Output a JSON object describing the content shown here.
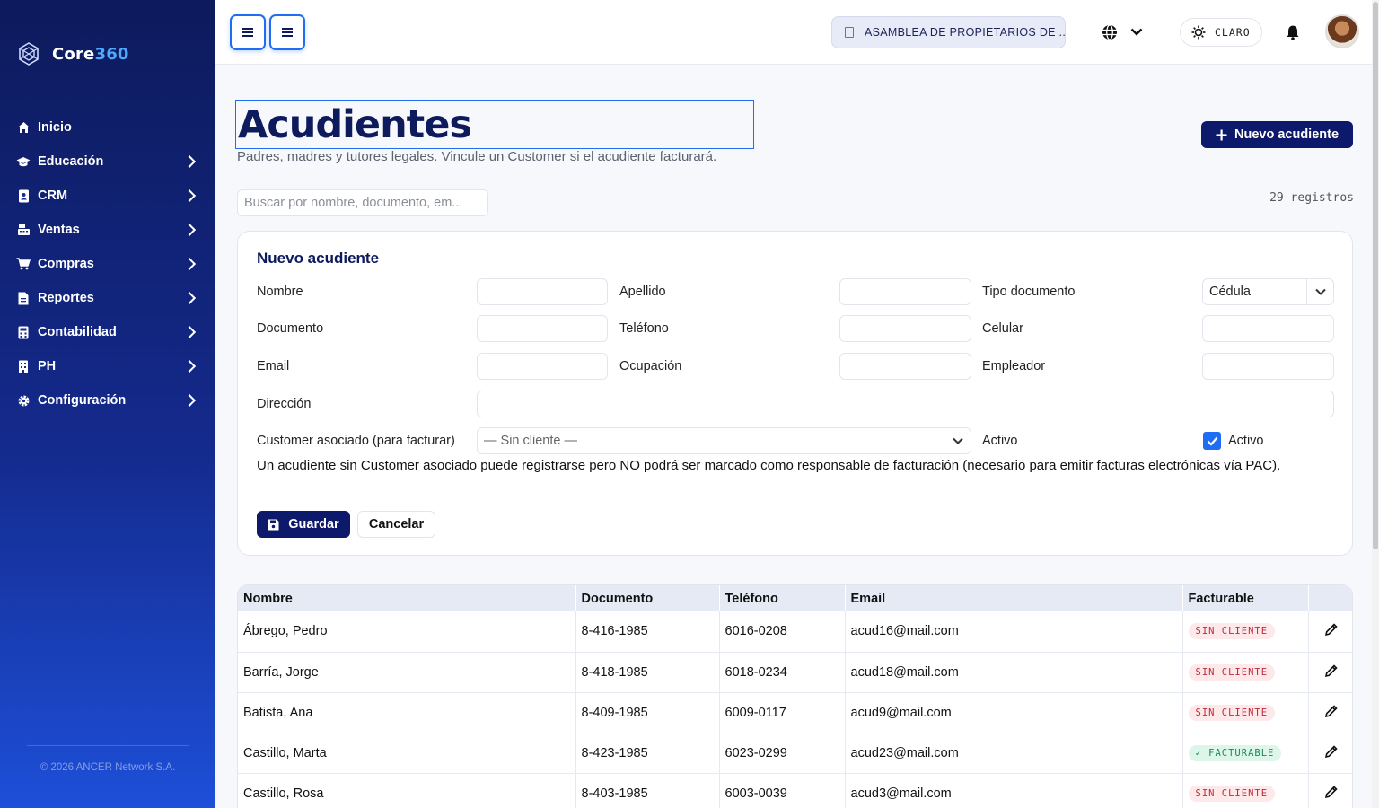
{
  "brand": {
    "name_part1": "Core",
    "name_part2": "360"
  },
  "sidebar": {
    "items": [
      {
        "label": "Inicio",
        "icon": "home-icon",
        "has_children": false
      },
      {
        "label": "Educación",
        "icon": "graduation-cap-icon",
        "has_children": true
      },
      {
        "label": "CRM",
        "icon": "contact-book-icon",
        "has_children": true
      },
      {
        "label": "Ventas",
        "icon": "cash-register-icon",
        "has_children": true
      },
      {
        "label": "Compras",
        "icon": "shopping-cart-icon",
        "has_children": true
      },
      {
        "label": "Reportes",
        "icon": "file-report-icon",
        "has_children": true
      },
      {
        "label": "Contabilidad",
        "icon": "calculator-icon",
        "has_children": true
      },
      {
        "label": "PH",
        "icon": "building-icon",
        "has_children": true
      },
      {
        "label": "Configuración",
        "icon": "gear-icon",
        "has_children": true
      }
    ],
    "footer": "© 2026 ANCER Network S.A."
  },
  "topbar": {
    "organization": "ASAMBLEA DE PROPIETARIOS DE ...",
    "theme_label": "CLARO"
  },
  "page": {
    "title": "Acudientes",
    "subtitle": "Padres, madres y tutores legales. Vincule un Customer si el acudiente facturará.",
    "new_button": "Nuevo acudiente",
    "search_placeholder": "Buscar por nombre, documento, em...",
    "record_count": "29 registros"
  },
  "form": {
    "title": "Nuevo acudiente",
    "labels": {
      "nombre": "Nombre",
      "apellido": "Apellido",
      "tipo_documento": "Tipo documento",
      "documento": "Documento",
      "telefono": "Teléfono",
      "celular": "Celular",
      "email": "Email",
      "ocupacion": "Ocupación",
      "empleador": "Empleador",
      "direccion": "Dirección",
      "customer": "Customer asociado (para facturar)",
      "activo": "Activo",
      "activo_check": "Activo"
    },
    "tipo_documento_value": "Cédula",
    "customer_value": "— Sin cliente —",
    "activo_checked": true,
    "note": "Un acudiente sin Customer asociado puede registrarse pero NO podrá ser marcado como responsable de facturación (necesario para emitir facturas electrónicas vía PAC).",
    "save_label": "Guardar",
    "cancel_label": "Cancelar"
  },
  "table": {
    "headers": [
      "Nombre",
      "Documento",
      "Teléfono",
      "Email",
      "Facturable",
      ""
    ],
    "rows": [
      {
        "nombre": "Ábrego, Pedro",
        "documento": "8-416-1985",
        "telefono": "6016-0208",
        "email": "acud16@mail.com",
        "facturable": "SIN CLIENTE",
        "status": "no"
      },
      {
        "nombre": "Barría, Jorge",
        "documento": "8-418-1985",
        "telefono": "6018-0234",
        "email": "acud18@mail.com",
        "facturable": "SIN CLIENTE",
        "status": "no"
      },
      {
        "nombre": "Batista, Ana",
        "documento": "8-409-1985",
        "telefono": "6009-0117",
        "email": "acud9@mail.com",
        "facturable": "SIN CLIENTE",
        "status": "no"
      },
      {
        "nombre": "Castillo, Marta",
        "documento": "8-423-1985",
        "telefono": "6023-0299",
        "email": "acud23@mail.com",
        "facturable": "✓ FACTURABLE",
        "status": "yes"
      },
      {
        "nombre": "Castillo, Rosa",
        "documento": "8-403-1985",
        "telefono": "6003-0039",
        "email": "acud3@mail.com",
        "facturable": "SIN CLIENTE",
        "status": "no"
      }
    ]
  },
  "colors": {
    "navy": "#0d1a6b",
    "accent": "#1e6df2",
    "badge_no": "#c4283a",
    "badge_yes": "#178a52"
  }
}
